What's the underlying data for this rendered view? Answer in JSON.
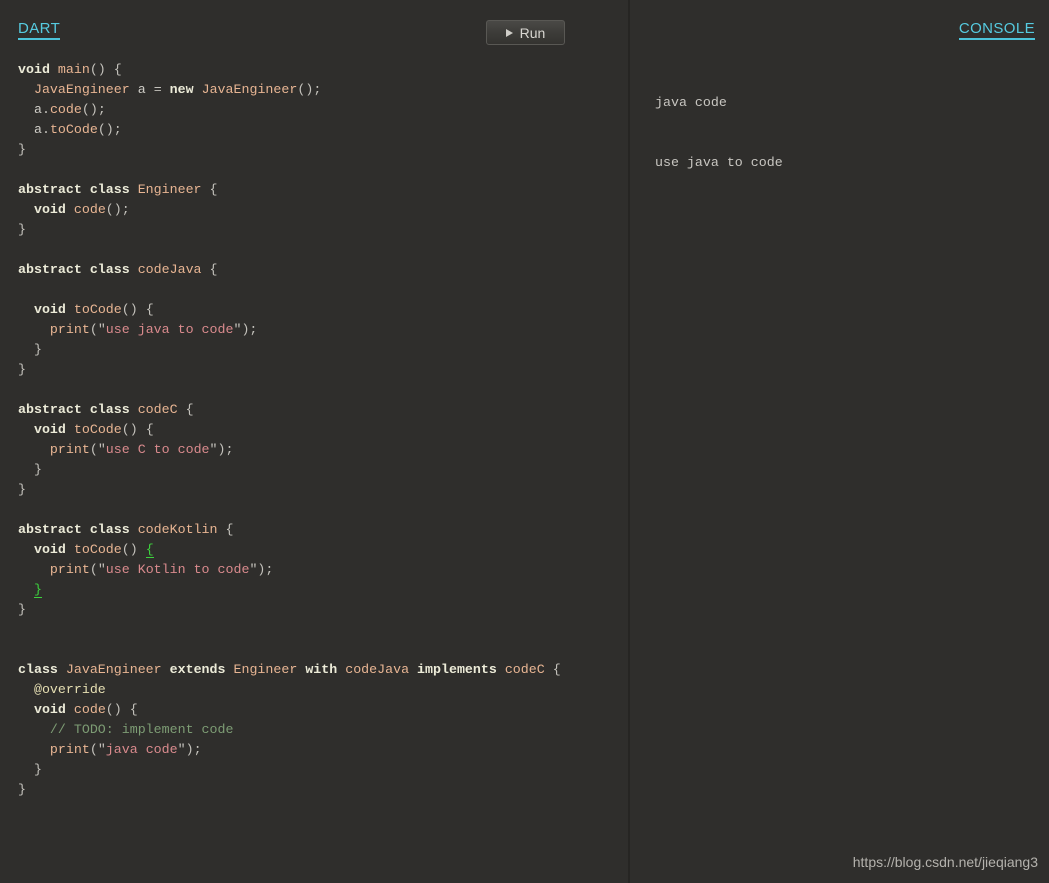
{
  "editor": {
    "language_label": "DART",
    "run_button": {
      "label": "Run",
      "icon": "play-triangle-icon"
    },
    "accent_color": "#4cc4da",
    "background_color": "#2f2e2c",
    "code_lines": [
      "void main() {",
      "  JavaEngineer a = new JavaEngineer();",
      "  a.code();",
      "  a.toCode();",
      "}",
      "",
      "abstract class Engineer {",
      "  void code();",
      "}",
      "",
      "abstract class codeJava {",
      "",
      "  void toCode() {",
      "    print(\"use java to code\");",
      "  }",
      "}",
      "",
      "abstract class codeC {",
      "  void toCode() {",
      "    print(\"use C to code\");",
      "  }",
      "}",
      "",
      "abstract class codeKotlin {",
      "  void toCode() {",
      "    print(\"use Kotlin to code\");",
      "  }",
      "}",
      "",
      "",
      "class JavaEngineer extends Engineer with codeJava implements codeC {",
      "  @override",
      "  void code() {",
      "    // TODO: implement code",
      "    print(\"java code\");",
      "  }",
      "}"
    ]
  },
  "console": {
    "label": "CONSOLE",
    "output_lines": [
      "java code",
      "use java to code"
    ]
  },
  "watermark": {
    "text": "https://blog.csdn.net/jieqiang3"
  }
}
